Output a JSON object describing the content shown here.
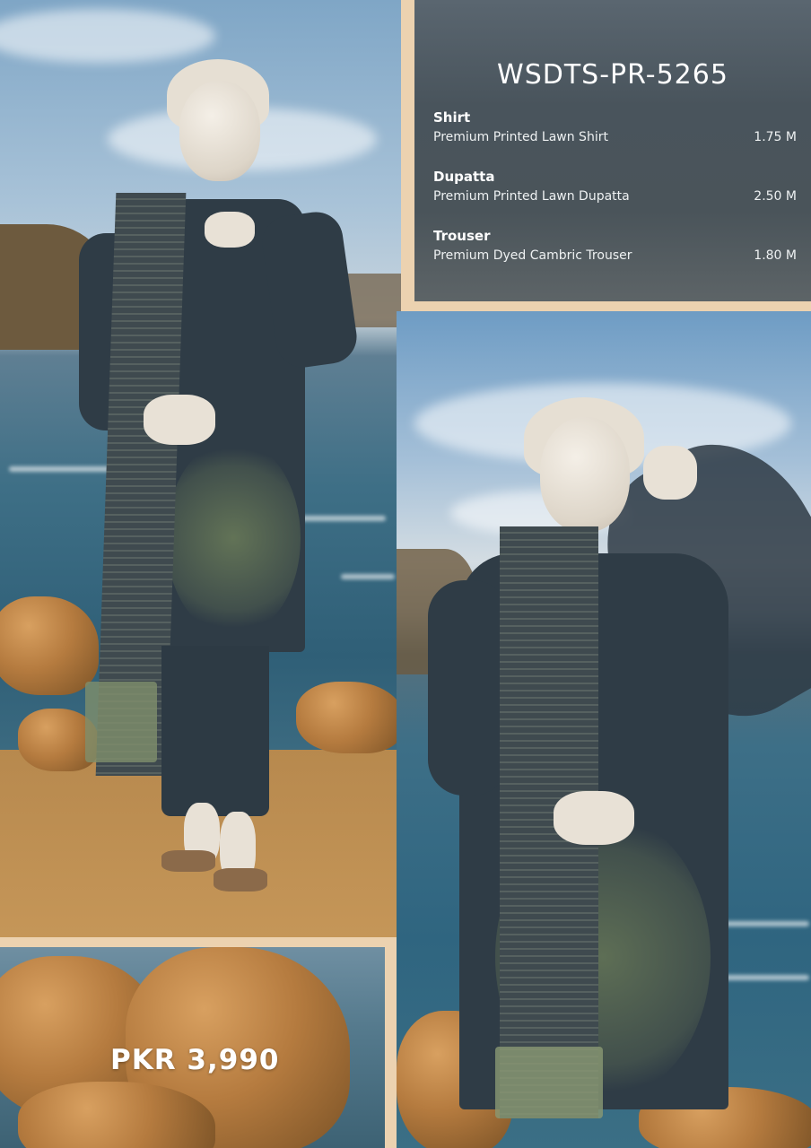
{
  "product": {
    "sku": "WSDTS-PR-5265",
    "items": [
      {
        "title": "Shirt",
        "description": "Premium Printed Lawn Shirt",
        "quantity": "1.75 M"
      },
      {
        "title": "Dupatta",
        "description": "Premium Printed Lawn Dupatta",
        "quantity": "2.50 M"
      },
      {
        "title": "Trouser",
        "description": "Premium Dyed Cambric Trouser",
        "quantity": "1.80 M"
      }
    ],
    "price": "PKR 3,990"
  },
  "colors": {
    "frame": "#ecd2b0",
    "info_panel": "#4c565d",
    "text": "#ffffff",
    "fabric": "#2f3c46"
  }
}
